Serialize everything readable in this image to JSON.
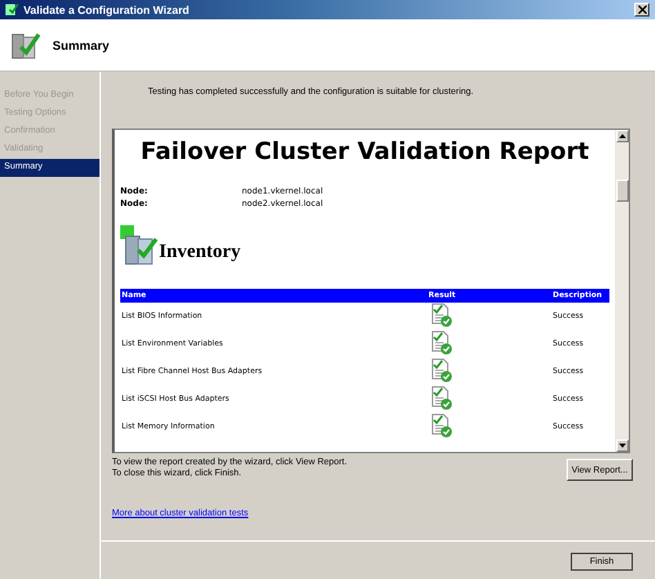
{
  "window": {
    "title": "Validate a Configuration Wizard"
  },
  "header": {
    "title": "Summary"
  },
  "steps": [
    {
      "label": "Before You Begin",
      "selected": false
    },
    {
      "label": "Testing Options",
      "selected": false
    },
    {
      "label": "Confirmation",
      "selected": false
    },
    {
      "label": "Validating",
      "selected": false
    },
    {
      "label": "Summary",
      "selected": true
    }
  ],
  "message": "Testing has completed successfully and the configuration is suitable for clustering.",
  "report": {
    "title": "Failover Cluster Validation Report",
    "nodes": [
      {
        "label": "Node:",
        "value": "node1.vkernel.local"
      },
      {
        "label": "Node:",
        "value": "node2.vkernel.local"
      }
    ],
    "section": "Inventory",
    "columns": [
      "Name",
      "Result",
      "Description"
    ],
    "rows": [
      {
        "name": "List BIOS Information",
        "description": "Success"
      },
      {
        "name": "List Environment Variables",
        "description": "Success"
      },
      {
        "name": "List Fibre Channel Host Bus Adapters",
        "description": "Success"
      },
      {
        "name": "List iSCSI Host Bus Adapters",
        "description": "Success"
      },
      {
        "name": "List Memory Information",
        "description": "Success"
      }
    ]
  },
  "instructions": [
    "To view the report created by the wizard, click View Report.",
    "To close this wizard, click Finish."
  ],
  "view_report_button": "View Report...",
  "link": "More about cluster validation tests",
  "finish_button": "Finish"
}
